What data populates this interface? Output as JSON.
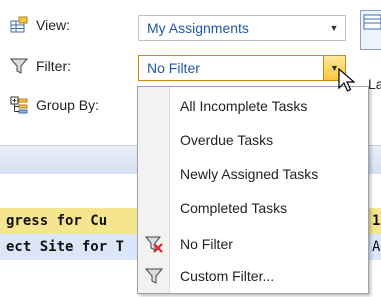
{
  "ribbon": {
    "view_label": "View:",
    "filter_label": "Filter:",
    "group_by_label": "Group By:",
    "view_value": "My Assignments",
    "filter_value": "No Filter",
    "right_clip_text": "La"
  },
  "rows": {
    "row1_text": "gress for Cu",
    "row1_right": "1",
    "row2_text": "ect Site for T",
    "row2_right": "A"
  },
  "filter_menu": {
    "items": [
      {
        "label": "All Incomplete Tasks",
        "icon": "none"
      },
      {
        "label": "Overdue Tasks",
        "icon": "none"
      },
      {
        "label": "Newly Assigned Tasks",
        "icon": "none"
      },
      {
        "label": "Completed Tasks",
        "icon": "none"
      },
      {
        "label": "No Filter",
        "icon": "clear-filter-icon"
      },
      {
        "label": "Custom Filter...",
        "icon": "funnel-icon"
      }
    ]
  },
  "colors": {
    "combo_text": "#1f57a6",
    "highlight_row": "#f5e58f",
    "selected_row": "#dbe7f8"
  }
}
